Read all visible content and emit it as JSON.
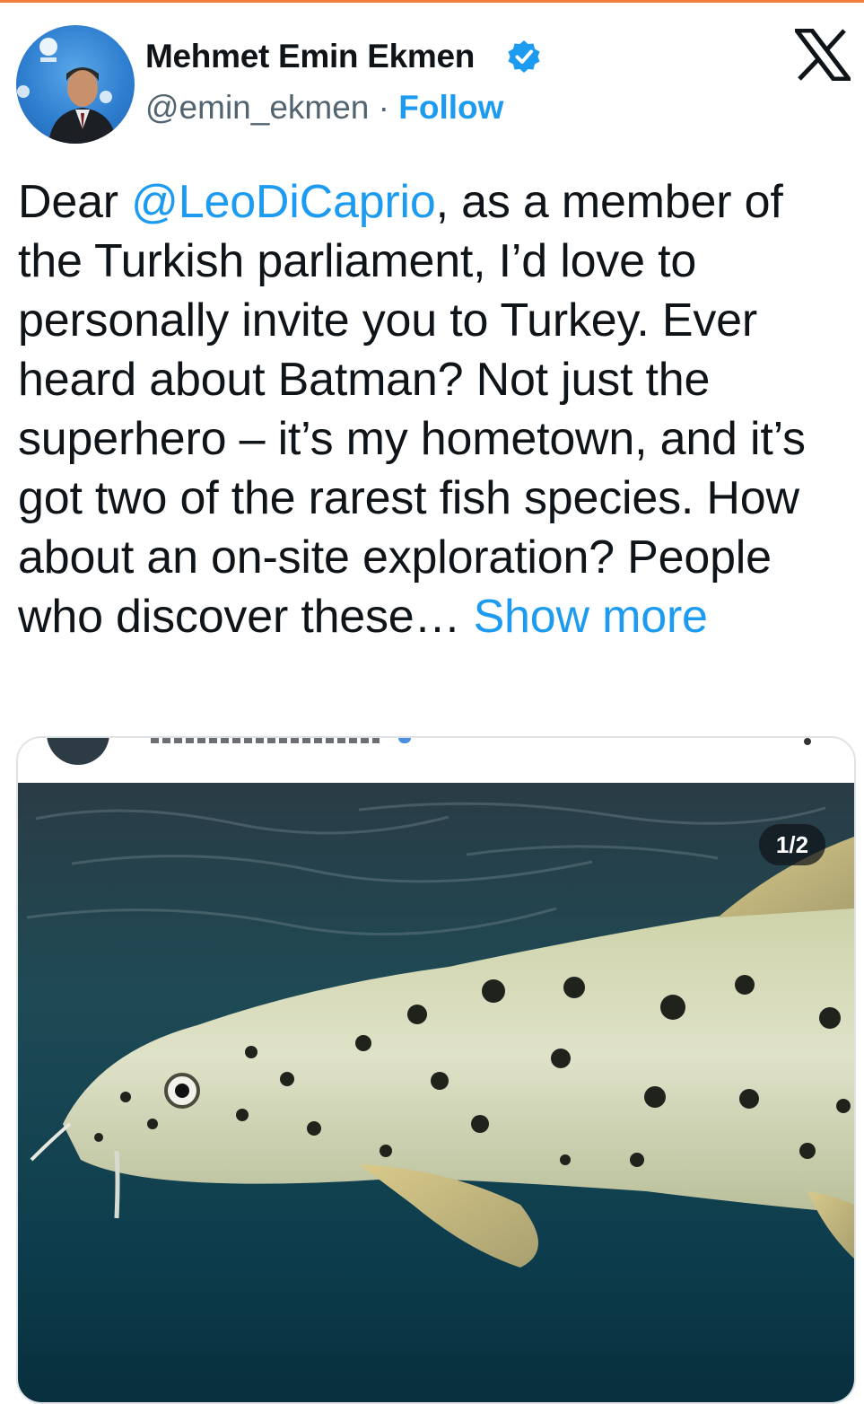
{
  "author": {
    "display_name": "Mehmet Emin Ekmen",
    "handle": "@emin_ekmen",
    "separator": "·",
    "follow_label": "Follow",
    "verified": true
  },
  "tweet": {
    "text_prefix": "Dear ",
    "mention": "@LeoDiCaprio",
    "text_body": ", as a member of the Turkish parliament, I’d love to personally invite you to Turkey. Ever heard about Batman? Not just the superhero – it’s my hometown, and it’s got two of the rarest fish species. How about an on-site exploration? People who discover these… ",
    "show_more_label": "Show more"
  },
  "media": {
    "counter": "1/2",
    "subject": "spotted catfish photo"
  },
  "colors": {
    "accent": "#1d9bf0",
    "text": "#0f1419",
    "secondary_text": "#536471",
    "top_strip": "#f0803c"
  },
  "icons": {
    "verified": "verified-badge-icon",
    "platform_logo": "x-logo-icon"
  }
}
